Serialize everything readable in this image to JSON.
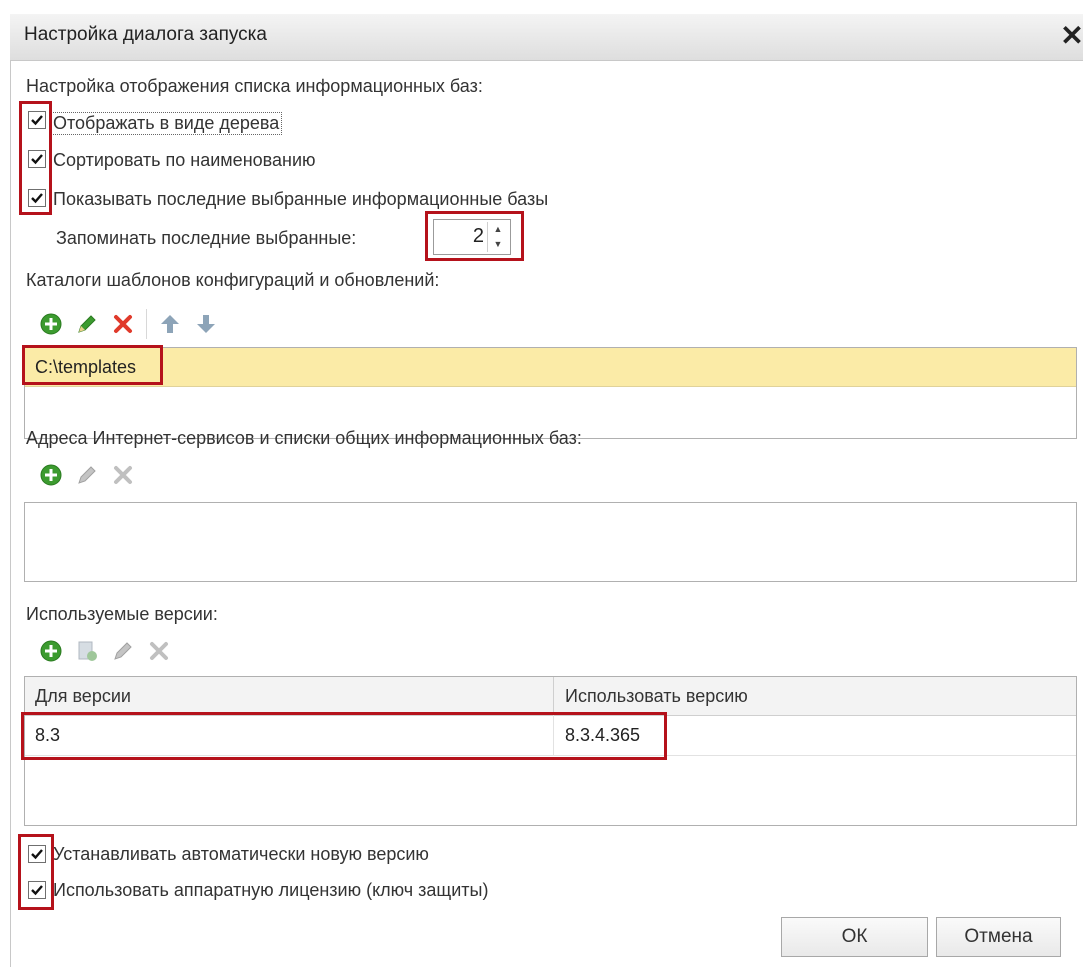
{
  "window": {
    "title": "Настройка диалога запуска",
    "close_icon": "close-icon"
  },
  "display_section": {
    "heading": "Настройка отображения списка информационных баз:",
    "checkboxes": [
      {
        "label": "Отображать в виде дерева",
        "checked": true
      },
      {
        "label": "Сортировать по наименованию",
        "checked": true
      },
      {
        "label": "Показывать последние выбранные информационные базы",
        "checked": true
      }
    ],
    "remember_label": "Запоминать последние выбранные:",
    "remember_value": "2"
  },
  "templates_section": {
    "heading": "Каталоги шаблонов конфигураций и обновлений:",
    "toolbar_icons": [
      "add-icon",
      "edit-icon",
      "delete-icon",
      "move-up-icon",
      "move-down-icon"
    ],
    "rows": [
      "C:\\templates"
    ]
  },
  "internet_section": {
    "heading": "Адреса Интернет-сервисов и списки общих информационных баз:",
    "toolbar_icons": [
      "add-icon",
      "edit-icon",
      "delete-icon"
    ],
    "rows": []
  },
  "versions_section": {
    "heading": "Используемые версии:",
    "toolbar_icons": [
      "add-icon",
      "copy-icon",
      "edit-icon",
      "delete-icon"
    ],
    "columns": [
      "Для версии",
      "Использовать версию"
    ],
    "rows": [
      [
        "8.3",
        "8.3.4.365"
      ]
    ]
  },
  "bottom_checkboxes": [
    {
      "label": "Устанавливать автоматически новую версию",
      "checked": true
    },
    {
      "label": "Использовать аппаратную лицензию (ключ защиты)",
      "checked": true
    }
  ],
  "buttons": {
    "ok": "ОК",
    "cancel": "Отмена"
  },
  "colors": {
    "highlight_border": "#b5121b",
    "selected_row": "#fbeba7",
    "add_green": "#3c9b2f",
    "delete_red": "#e03a2b"
  }
}
